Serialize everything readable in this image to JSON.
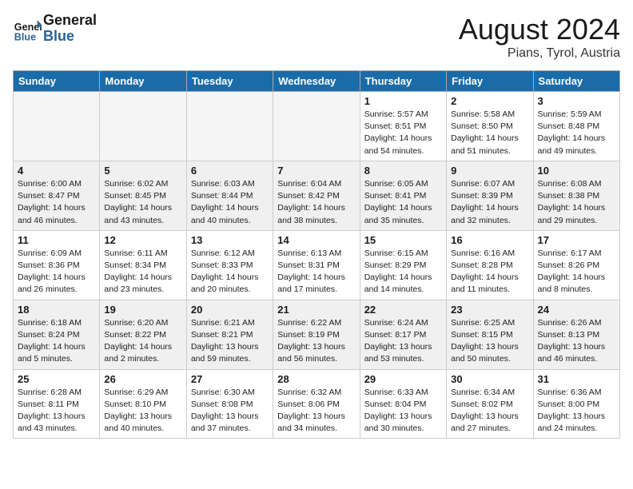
{
  "header": {
    "logo_general": "General",
    "logo_blue": "Blue",
    "month_year": "August 2024",
    "location": "Pians, Tyrol, Austria"
  },
  "days_of_week": [
    "Sunday",
    "Monday",
    "Tuesday",
    "Wednesday",
    "Thursday",
    "Friday",
    "Saturday"
  ],
  "weeks": [
    [
      {
        "day": "",
        "empty": true
      },
      {
        "day": "",
        "empty": true
      },
      {
        "day": "",
        "empty": true
      },
      {
        "day": "",
        "empty": true
      },
      {
        "day": "1",
        "sunrise": "5:57 AM",
        "sunset": "8:51 PM",
        "daylight": "14 hours and 54 minutes."
      },
      {
        "day": "2",
        "sunrise": "5:58 AM",
        "sunset": "8:50 PM",
        "daylight": "14 hours and 51 minutes."
      },
      {
        "day": "3",
        "sunrise": "5:59 AM",
        "sunset": "8:48 PM",
        "daylight": "14 hours and 49 minutes."
      }
    ],
    [
      {
        "day": "4",
        "sunrise": "6:00 AM",
        "sunset": "8:47 PM",
        "daylight": "14 hours and 46 minutes."
      },
      {
        "day": "5",
        "sunrise": "6:02 AM",
        "sunset": "8:45 PM",
        "daylight": "14 hours and 43 minutes."
      },
      {
        "day": "6",
        "sunrise": "6:03 AM",
        "sunset": "8:44 PM",
        "daylight": "14 hours and 40 minutes."
      },
      {
        "day": "7",
        "sunrise": "6:04 AM",
        "sunset": "8:42 PM",
        "daylight": "14 hours and 38 minutes."
      },
      {
        "day": "8",
        "sunrise": "6:05 AM",
        "sunset": "8:41 PM",
        "daylight": "14 hours and 35 minutes."
      },
      {
        "day": "9",
        "sunrise": "6:07 AM",
        "sunset": "8:39 PM",
        "daylight": "14 hours and 32 minutes."
      },
      {
        "day": "10",
        "sunrise": "6:08 AM",
        "sunset": "8:38 PM",
        "daylight": "14 hours and 29 minutes."
      }
    ],
    [
      {
        "day": "11",
        "sunrise": "6:09 AM",
        "sunset": "8:36 PM",
        "daylight": "14 hours and 26 minutes."
      },
      {
        "day": "12",
        "sunrise": "6:11 AM",
        "sunset": "8:34 PM",
        "daylight": "14 hours and 23 minutes."
      },
      {
        "day": "13",
        "sunrise": "6:12 AM",
        "sunset": "8:33 PM",
        "daylight": "14 hours and 20 minutes."
      },
      {
        "day": "14",
        "sunrise": "6:13 AM",
        "sunset": "8:31 PM",
        "daylight": "14 hours and 17 minutes."
      },
      {
        "day": "15",
        "sunrise": "6:15 AM",
        "sunset": "8:29 PM",
        "daylight": "14 hours and 14 minutes."
      },
      {
        "day": "16",
        "sunrise": "6:16 AM",
        "sunset": "8:28 PM",
        "daylight": "14 hours and 11 minutes."
      },
      {
        "day": "17",
        "sunrise": "6:17 AM",
        "sunset": "8:26 PM",
        "daylight": "14 hours and 8 minutes."
      }
    ],
    [
      {
        "day": "18",
        "sunrise": "6:18 AM",
        "sunset": "8:24 PM",
        "daylight": "14 hours and 5 minutes."
      },
      {
        "day": "19",
        "sunrise": "6:20 AM",
        "sunset": "8:22 PM",
        "daylight": "14 hours and 2 minutes."
      },
      {
        "day": "20",
        "sunrise": "6:21 AM",
        "sunset": "8:21 PM",
        "daylight": "13 hours and 59 minutes."
      },
      {
        "day": "21",
        "sunrise": "6:22 AM",
        "sunset": "8:19 PM",
        "daylight": "13 hours and 56 minutes."
      },
      {
        "day": "22",
        "sunrise": "6:24 AM",
        "sunset": "8:17 PM",
        "daylight": "13 hours and 53 minutes."
      },
      {
        "day": "23",
        "sunrise": "6:25 AM",
        "sunset": "8:15 PM",
        "daylight": "13 hours and 50 minutes."
      },
      {
        "day": "24",
        "sunrise": "6:26 AM",
        "sunset": "8:13 PM",
        "daylight": "13 hours and 46 minutes."
      }
    ],
    [
      {
        "day": "25",
        "sunrise": "6:28 AM",
        "sunset": "8:11 PM",
        "daylight": "13 hours and 43 minutes."
      },
      {
        "day": "26",
        "sunrise": "6:29 AM",
        "sunset": "8:10 PM",
        "daylight": "13 hours and 40 minutes."
      },
      {
        "day": "27",
        "sunrise": "6:30 AM",
        "sunset": "8:08 PM",
        "daylight": "13 hours and 37 minutes."
      },
      {
        "day": "28",
        "sunrise": "6:32 AM",
        "sunset": "8:06 PM",
        "daylight": "13 hours and 34 minutes."
      },
      {
        "day": "29",
        "sunrise": "6:33 AM",
        "sunset": "8:04 PM",
        "daylight": "13 hours and 30 minutes."
      },
      {
        "day": "30",
        "sunrise": "6:34 AM",
        "sunset": "8:02 PM",
        "daylight": "13 hours and 27 minutes."
      },
      {
        "day": "31",
        "sunrise": "6:36 AM",
        "sunset": "8:00 PM",
        "daylight": "13 hours and 24 minutes."
      }
    ]
  ],
  "labels": {
    "sunrise": "Sunrise:",
    "sunset": "Sunset:",
    "daylight": "Daylight:"
  }
}
